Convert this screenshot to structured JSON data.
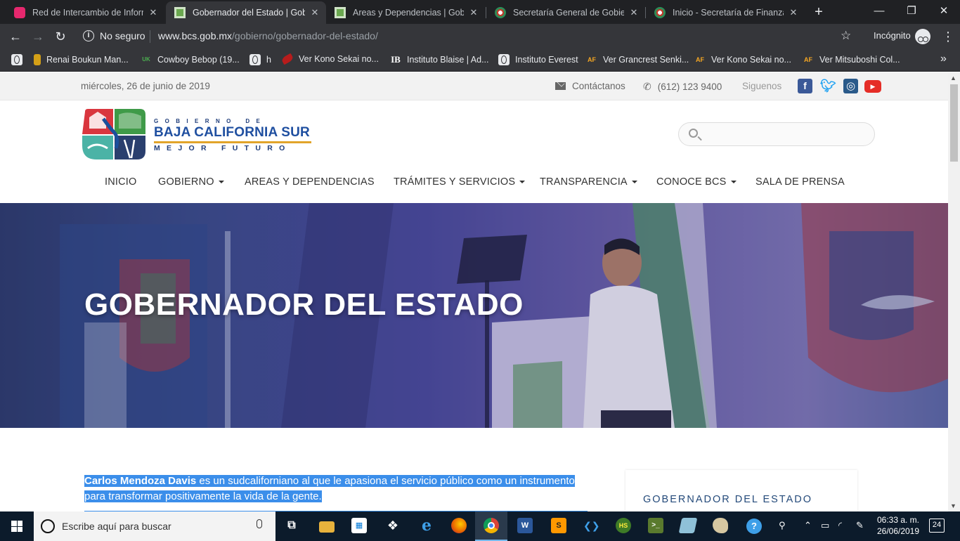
{
  "browser": {
    "tabs": [
      {
        "title": "Red de Intercambio de Informa",
        "favicon_color": "#e6286e",
        "active": false
      },
      {
        "title": "Gobernador del Estado | Gobie",
        "favicon_color": "#6aa84f",
        "active": true
      },
      {
        "title": "Areas y Dependencias | Gobier",
        "favicon_color": "#6aa84f",
        "active": false
      },
      {
        "title": "Secretaría General de Gobierno",
        "favicon_color": "#c0392b",
        "active": false
      },
      {
        "title": "Inicio - Secretaría de Finanzas",
        "favicon_color": "#c0392b",
        "active": false
      }
    ],
    "new_tab_icon": "plus-icon",
    "window_buttons": [
      "minimize-icon",
      "maximize-icon",
      "close-icon"
    ],
    "security_label": "No seguro",
    "url_host": "www.bcs.gob.mx",
    "url_path": "/gobierno/gobernador-del-estado/",
    "incognito_label": "Incógnito",
    "bookmarks": [
      {
        "label": "Renai Boukun Man...",
        "icon_color": "#d4a017"
      },
      {
        "label": "Cowboy Bebop (19...",
        "icon_color": "#2e7d32"
      },
      {
        "label": "h",
        "icon": "globe-icon"
      },
      {
        "label": "Ver Kono Sekai no...",
        "icon_color": "#b71c1c"
      },
      {
        "label": "Instituto Blaise | Ad...",
        "icon_text": "IB"
      },
      {
        "label": "Instituto Everest",
        "icon": "globe-icon"
      },
      {
        "label": "Ver Grancrest Senki...",
        "icon_text": "AF"
      },
      {
        "label": "Ver Kono Sekai no...",
        "icon_text": "AF"
      },
      {
        "label": "Ver Mitsuboshi Col...",
        "icon_text": "AF"
      }
    ],
    "bookmarks_more": "»"
  },
  "site": {
    "topbar": {
      "date": "miércoles, 26 de junio de 2019",
      "contact_label": "Contáctanos",
      "phone": "(612) 123 9400",
      "follow_label": "Siguenos",
      "social": [
        {
          "name": "facebook-icon",
          "color": "#3b5998",
          "glyph": "f"
        },
        {
          "name": "twitter-icon",
          "color": "#1da1f2",
          "glyph": "t"
        },
        {
          "name": "instagram-icon",
          "color": "#2a5a8a",
          "glyph": "◎"
        },
        {
          "name": "youtube-icon",
          "color": "#e52d27",
          "glyph": "▶"
        }
      ]
    },
    "logo": {
      "line1": "GOBIERNO DE",
      "line2": "BAJA CALIFORNIA SUR",
      "line3": "MEJOR FUTURO"
    },
    "search": {
      "placeholder": "",
      "value": ""
    },
    "menu": [
      {
        "label": "INICIO",
        "dropdown": false
      },
      {
        "label": "GOBIERNO",
        "dropdown": true
      },
      {
        "label": "AREAS Y DEPENDENCIAS",
        "dropdown": false
      },
      {
        "label": "TRÁMITES Y SERVICIOS",
        "dropdown": true
      },
      {
        "label": "TRANSPARENCIA",
        "dropdown": true
      },
      {
        "label": "CONOCE BCS",
        "dropdown": true
      },
      {
        "label": "SALA DE PRENSA",
        "dropdown": false
      }
    ],
    "hero_title": "GOBERNADOR DEL ESTADO",
    "intro": {
      "name": "Carlos Mendoza Davis",
      "text_1": " es un sudcaliforniano al que le apasiona el servicio público como un instrumento",
      "text_2": "para transformar positivamente la vida de la gente."
    },
    "sidebar_heading": "GOBERNADOR DEL ESTADO",
    "accent_color": "#1f4fa0",
    "selection_color": "#3b8eea"
  },
  "taskbar": {
    "search_placeholder": "Escribe aquí para buscar",
    "apps": [
      {
        "name": "task-view-icon",
        "color": "#0c1b2b",
        "glyph": "⧉"
      },
      {
        "name": "file-explorer-icon",
        "color": "#e8b23c",
        "glyph": ""
      },
      {
        "name": "store-icon",
        "color": "#ffffff",
        "glyph": "🛍"
      },
      {
        "name": "dropbox-icon",
        "color": "#0c1b2b",
        "glyph": "❖"
      },
      {
        "name": "edge-icon",
        "color": "#0c1b2b",
        "glyph": "e"
      },
      {
        "name": "firefox-icon",
        "color": "#e66000",
        "glyph": ""
      },
      {
        "name": "chrome-icon",
        "color": "#4285f4",
        "glyph": "",
        "active": true
      },
      {
        "name": "word-icon",
        "color": "#2b579a",
        "glyph": "W"
      },
      {
        "name": "sublime-icon",
        "color": "#ff9800",
        "glyph": "S"
      },
      {
        "name": "vscode-icon",
        "color": "#0c1b2b",
        "glyph": "❮❯"
      },
      {
        "name": "hotspot-icon",
        "color": "#3e7b27",
        "glyph": "HS"
      },
      {
        "name": "terminal-icon",
        "color": "#5a7a2e",
        "glyph": ">_"
      },
      {
        "name": "notes-icon",
        "color": "#8fc1d8",
        "glyph": ""
      },
      {
        "name": "paint-icon",
        "color": "#d6c7a1",
        "glyph": ""
      }
    ],
    "clock_time": "06:33 a. m.",
    "clock_date": "26/06/2019",
    "notification_count": "24"
  }
}
